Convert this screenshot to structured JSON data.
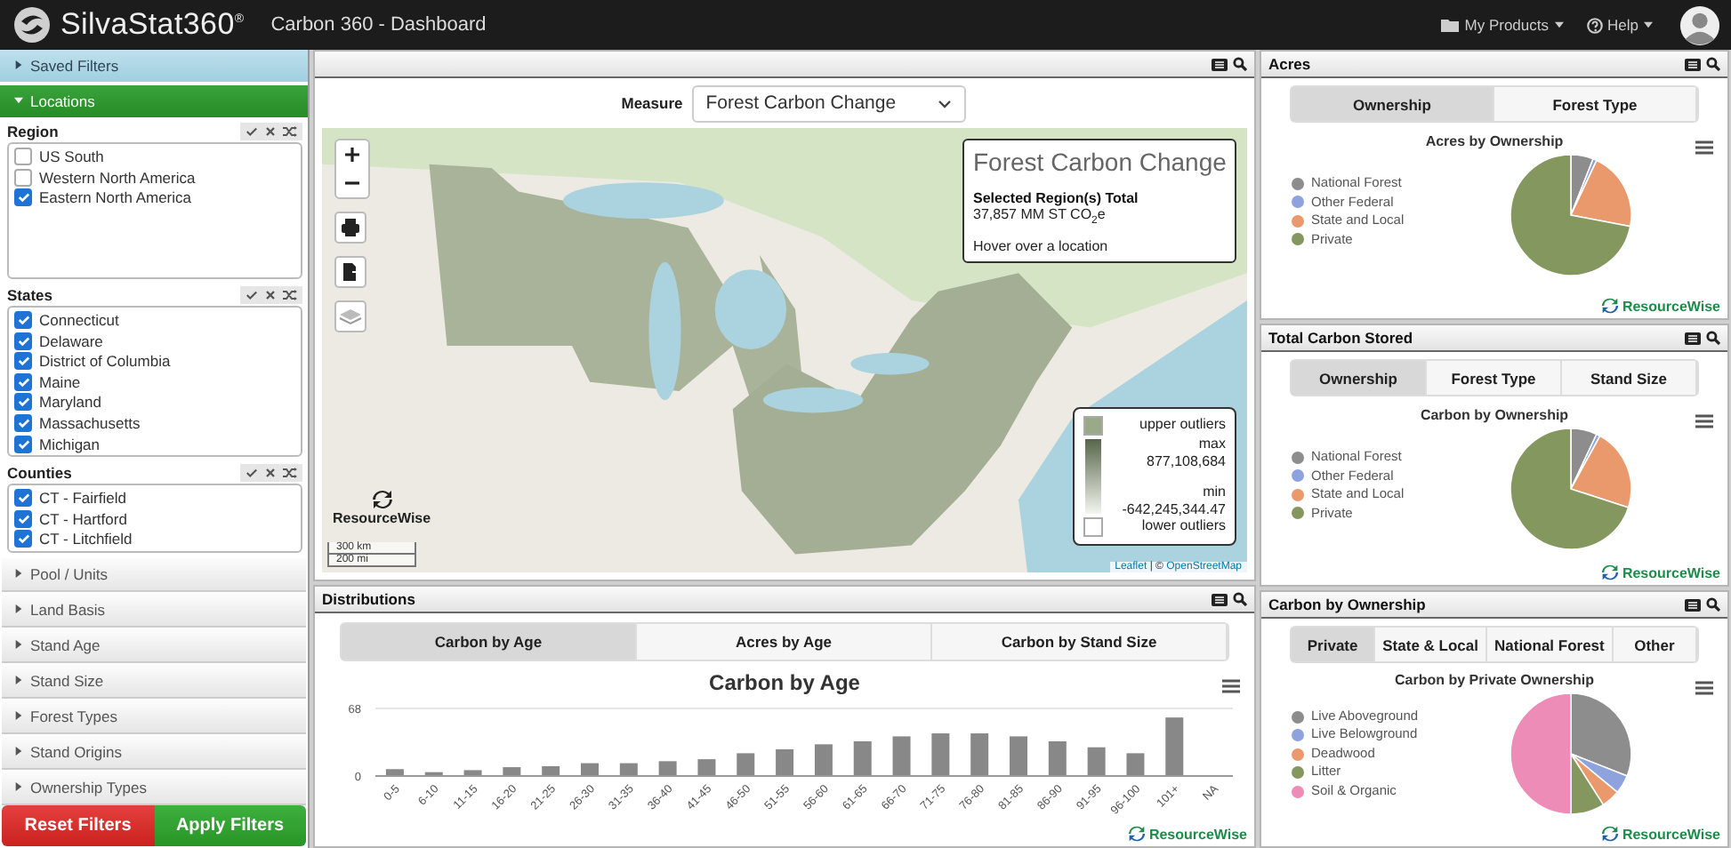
{
  "header": {
    "logo": "SilvaStat360$^{®}$",
    "title": "Carbon 360 - Dashboard",
    "menus": [
      {
        "label": "My Products",
        "kind": "products"
      },
      {
        "label": "Help",
        "kind": "help"
      }
    ]
  },
  "sidebar": {
    "sections": [
      {
        "label": "Saved Filters",
        "expanded": false
      },
      {
        "label": "Locations",
        "expanded": true
      }
    ],
    "lists": [
      {
        "title": "Region",
        "items": [
          {
            "label": "US South",
            "checked": false
          },
          {
            "label": "Western North America",
            "checked": false
          },
          {
            "label": "Eastern North America",
            "checked": true
          }
        ]
      },
      {
        "title": "States",
        "items": [
          {
            "label": "Connecticut",
            "checked": true
          },
          {
            "label": "Delaware",
            "checked": true
          },
          {
            "label": "District of Columbia",
            "checked": true
          },
          {
            "label": "Maine",
            "checked": true
          },
          {
            "label": "Maryland",
            "checked": true
          },
          {
            "label": "Massachusetts",
            "checked": true
          },
          {
            "label": "Michigan",
            "checked": true
          }
        ]
      },
      {
        "title": "Counties",
        "items": [
          {
            "label": "CT - Fairfield",
            "checked": true
          },
          {
            "label": "CT - Hartford",
            "checked": true
          },
          {
            "label": "CT - Litchfield",
            "checked": true
          }
        ]
      }
    ],
    "filters": [
      {
        "label": "Pool / Units",
        "expanded": false
      },
      {
        "label": "Land Basis",
        "expanded": false
      },
      {
        "label": "Stand Age",
        "expanded": false
      },
      {
        "label": "Stand Size",
        "expanded": false
      },
      {
        "label": "Forest Types",
        "expanded": false
      },
      {
        "label": "Stand Origins",
        "expanded": false
      },
      {
        "label": "Ownership Types",
        "expanded": false
      }
    ],
    "buttons": [
      {
        "label": "Reset Filters",
        "kind": "reset"
      },
      {
        "label": "Apply Filters",
        "kind": "apply"
      }
    ]
  },
  "map_panel": {
    "measure_label": "Measure",
    "measure_value": "Forest Carbon Change",
    "info": {
      "title": "Forest Carbon Change",
      "subtitle": "Selected Region(s) Total",
      "total": "37,857 MM ST CO$_{2}$e",
      "hint": "Hover over a location"
    },
    "legend": {
      "upper": "upper outliers",
      "max_label": "max",
      "max_value": "877,108,684",
      "min_label": "min",
      "min_value": "-642,245,344.47",
      "lower": "lower outliers"
    },
    "brand": "ResourceWise",
    "scale": [
      "300 km",
      "200 mi"
    ],
    "attribution": {
      "leaflet": "Leaflet",
      "separator": "| ©",
      "osm": "OpenStreetMap"
    }
  },
  "distributions": {
    "title": "Distributions",
    "tabs": [
      {
        "label": "Carbon by Age",
        "selected": true
      },
      {
        "label": "Acres by Age",
        "selected": false
      },
      {
        "label": "Carbon by Stand Size",
        "selected": false
      }
    ],
    "chart_data": {
      "type": "bar",
      "title": "Carbon by Age",
      "categories": [
        "0-5",
        "6-10",
        "11-15",
        "16-20",
        "21-25",
        "26-30",
        "31-35",
        "36-40",
        "41-45",
        "46-50",
        "51-55",
        "56-60",
        "61-65",
        "66-70",
        "71-75",
        "76-80",
        "81-85",
        "86-90",
        "91-95",
        "96-100",
        "101+",
        "NA"
      ],
      "values": [
        6,
        3,
        5,
        8,
        9,
        12,
        12,
        14,
        16,
        22,
        26,
        31,
        34,
        39,
        42,
        42,
        39,
        34,
        28,
        22,
        58,
        0
      ],
      "ylim": [
        0,
        68
      ],
      "yticks": [
        0,
        68
      ]
    },
    "brand": "ResourceWise"
  },
  "right_panels": [
    {
      "title": "Acres",
      "tabs": [
        {
          "label": "Ownership",
          "selected": true
        },
        {
          "label": "Forest Type",
          "selected": false
        }
      ],
      "chart_title": "Acres by Ownership",
      "legend": [
        {
          "label": "National Forest",
          "color": "#8d8d8d"
        },
        {
          "label": "Other Federal",
          "color": "#8ea2dd"
        },
        {
          "label": "State and Local",
          "color": "#e9996b"
        },
        {
          "label": "Private",
          "color": "#84975f"
        }
      ],
      "brand": "ResourceWise"
    },
    {
      "title": "Total Carbon Stored",
      "tabs": [
        {
          "label": "Ownership",
          "selected": true
        },
        {
          "label": "Forest Type",
          "selected": false
        },
        {
          "label": "Stand Size",
          "selected": false
        }
      ],
      "chart_title": "Carbon by Ownership",
      "legend": [
        {
          "label": "National Forest",
          "color": "#8d8d8d"
        },
        {
          "label": "Other Federal",
          "color": "#8ea2dd"
        },
        {
          "label": "State and Local",
          "color": "#e9996b"
        },
        {
          "label": "Private",
          "color": "#84975f"
        }
      ],
      "brand": "ResourceWise"
    },
    {
      "title": "Carbon by Ownership",
      "tabs": [
        {
          "label": "Private",
          "selected": true
        },
        {
          "label": "State & Local",
          "selected": false
        },
        {
          "label": "National Forest",
          "selected": false
        },
        {
          "label": "Other",
          "selected": false
        }
      ],
      "chart_title": "Carbon by Private Ownership",
      "legend": [
        {
          "label": "Live Aboveground",
          "color": "#8d8d8d"
        },
        {
          "label": "Live Belowground",
          "color": "#8ea2dd"
        },
        {
          "label": "Deadwood",
          "color": "#e9996b"
        },
        {
          "label": "Litter",
          "color": "#84975f"
        },
        {
          "label": "Soil & Organic",
          "color": "#ee8cb8"
        }
      ],
      "brand": "ResourceWise"
    }
  ]
}
